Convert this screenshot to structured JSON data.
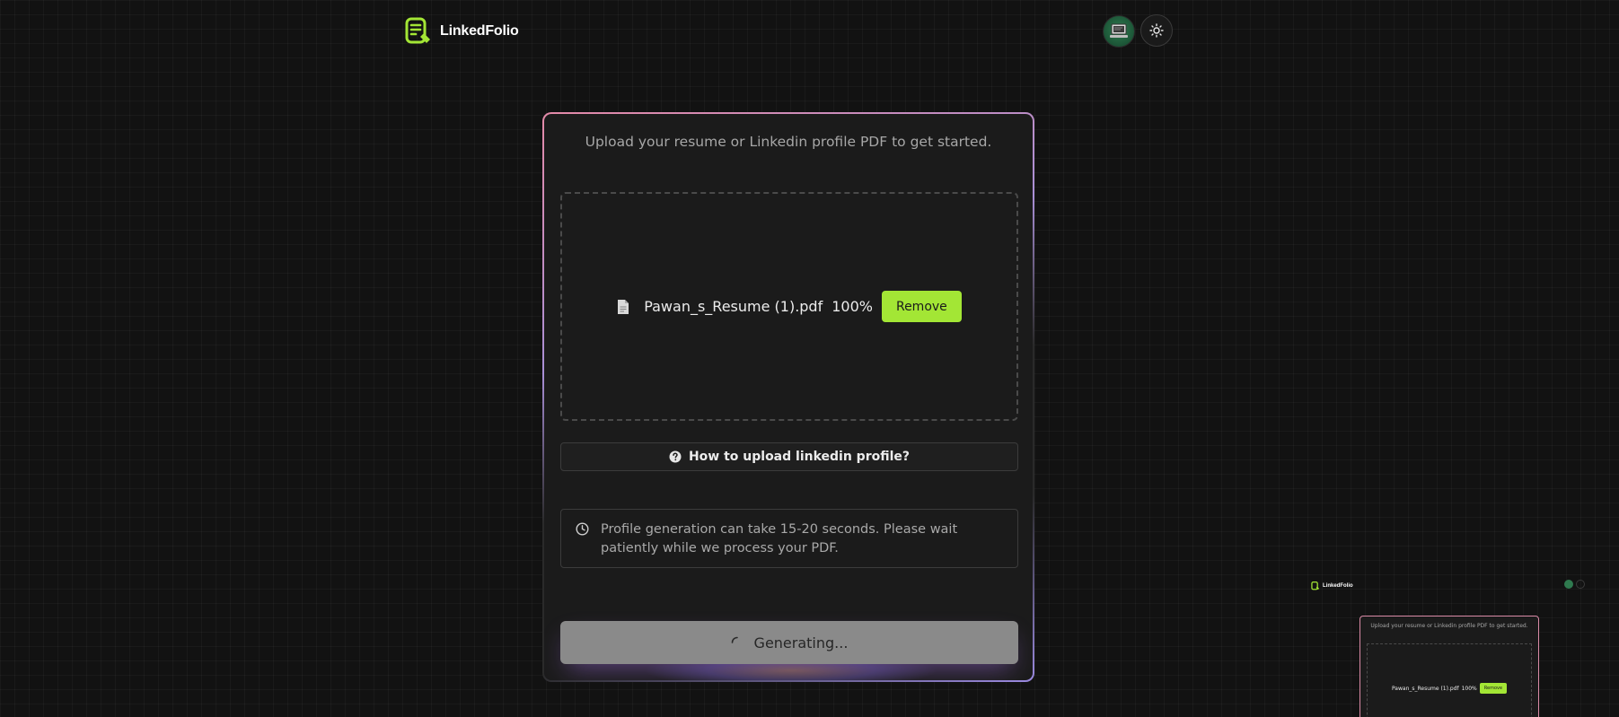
{
  "header": {
    "app_name": "LinkedFolio",
    "logo_icon": "document-edit-icon",
    "avatar_icon": "laptop-avatar-icon",
    "theme_toggle_icon": "sun-icon"
  },
  "upload_card": {
    "title": "Upload your resume or Linkedin profile PDF to get started.",
    "file": {
      "icon": "file-icon",
      "name": "Pawan_s_Resume (1).pdf",
      "progress": "100%",
      "remove_label": "Remove"
    },
    "how_to": {
      "icon": "question-circle-icon",
      "label": "How to upload linkedin profile?"
    },
    "info": {
      "icon": "clock-icon",
      "text": "Profile generation can take 15-20 seconds. Please wait patiently while we process your PDF."
    },
    "generate": {
      "icon": "spinner-icon",
      "label": "Generating..."
    }
  },
  "colors": {
    "accent": "#a3e635",
    "background": "#121212",
    "card": "#1b1b1b",
    "disabled_button": "#8a8a8a"
  },
  "preview": {
    "app_name": "LinkedFolio",
    "title": "Upload your resume or Linkedin profile PDF to get started.",
    "file_name": "Pawan_s_Resume (1).pdf",
    "progress": "100%",
    "remove_label": "Remove"
  }
}
